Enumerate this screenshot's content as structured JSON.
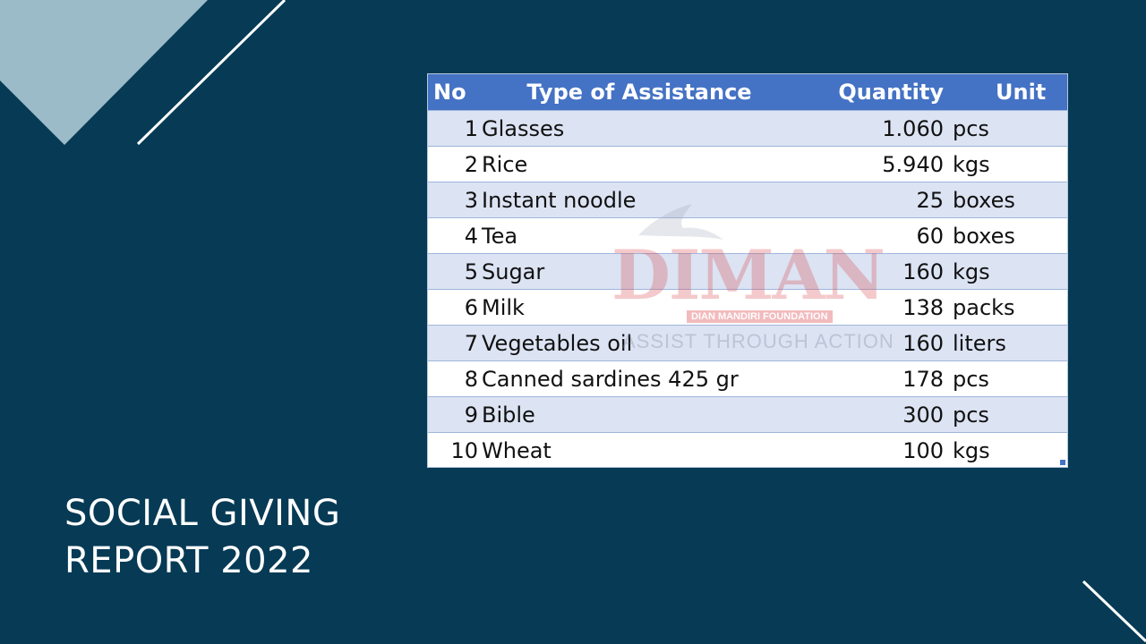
{
  "slide": {
    "title_line1": "SOCIAL GIVING",
    "title_line2": "REPORT 2022",
    "colors": {
      "background": "#063a55",
      "triangle": "#9bbbc8",
      "line": "#ffffff",
      "table_header": "#4472c4",
      "table_band": "#d9e1f2"
    }
  },
  "table": {
    "headers": {
      "no": "No",
      "type": "Type of Assistance",
      "quantity": "Quantity",
      "unit": "Unit"
    },
    "rows": [
      {
        "no": "1",
        "type": "Glasses",
        "quantity": "1.060",
        "unit": "pcs"
      },
      {
        "no": "2",
        "type": "Rice",
        "quantity": "5.940",
        "unit": "kgs"
      },
      {
        "no": "3",
        "type": "Instant noodle",
        "quantity": "25",
        "unit": "boxes"
      },
      {
        "no": "4",
        "type": "Tea",
        "quantity": "60",
        "unit": "boxes"
      },
      {
        "no": "5",
        "type": "Sugar",
        "quantity": "160",
        "unit": "kgs"
      },
      {
        "no": "6",
        "type": "Milk",
        "quantity": "138",
        "unit": "packs"
      },
      {
        "no": "7",
        "type": "Vegetables oil",
        "quantity": "160",
        "unit": "liters"
      },
      {
        "no": "8",
        "type": "Canned sardines 425 gr",
        "quantity": "178",
        "unit": "pcs"
      },
      {
        "no": "9",
        "type": "Bible",
        "quantity": "300",
        "unit": "pcs"
      },
      {
        "no": "10",
        "type": "Wheat",
        "quantity": "100",
        "unit": "kgs"
      }
    ]
  },
  "watermark": {
    "logo_text": "DIMAN",
    "foundation": "DIAN MANDIRI FOUNDATION",
    "tagline": "ASSIST THROUGH ACTION"
  }
}
